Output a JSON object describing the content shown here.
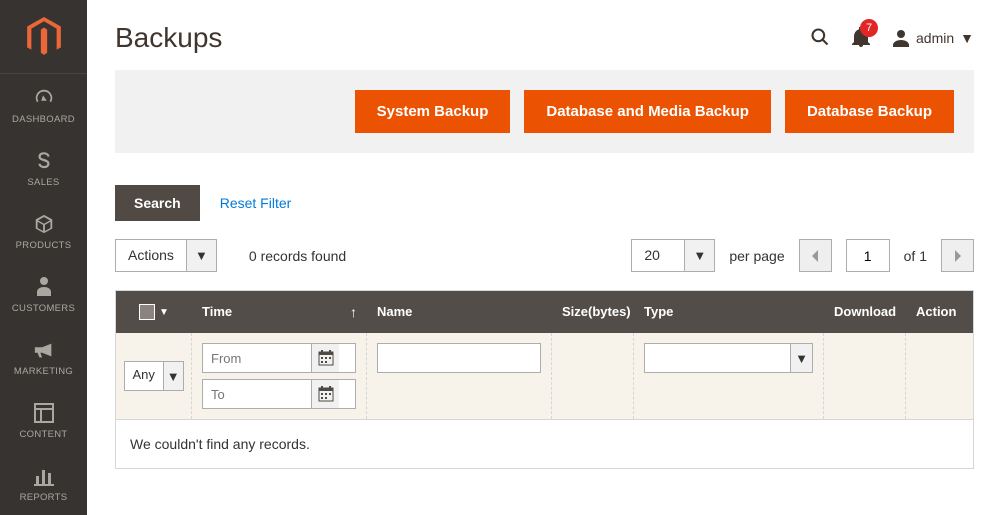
{
  "sidebar": {
    "items": [
      {
        "label": "DASHBOARD",
        "icon": "dashboard"
      },
      {
        "label": "SALES",
        "icon": "dollar"
      },
      {
        "label": "PRODUCTS",
        "icon": "cube"
      },
      {
        "label": "CUSTOMERS",
        "icon": "person"
      },
      {
        "label": "MARKETING",
        "icon": "megaphone"
      },
      {
        "label": "CONTENT",
        "icon": "layout"
      },
      {
        "label": "REPORTS",
        "icon": "bar-chart"
      }
    ]
  },
  "header": {
    "title": "Backups",
    "notifications": "7",
    "user_label": "admin"
  },
  "actions": {
    "system_backup": "System Backup",
    "db_media_backup": "Database and Media Backup",
    "db_backup": "Database Backup"
  },
  "toolbar": {
    "search_label": "Search",
    "reset_label": "Reset Filter"
  },
  "controls": {
    "actions_label": "Actions",
    "records_found": "0 records found",
    "per_page_value": "20",
    "per_page_label": "per page",
    "page_value": "1",
    "of_label": "of 1"
  },
  "grid": {
    "columns": {
      "time": "Time",
      "name": "Name",
      "size": "Size(bytes)",
      "type": "Type",
      "download": "Download",
      "action": "Action"
    },
    "filter": {
      "any": "Any",
      "from_ph": "From",
      "to_ph": "To"
    },
    "empty": "We couldn't find any records."
  }
}
